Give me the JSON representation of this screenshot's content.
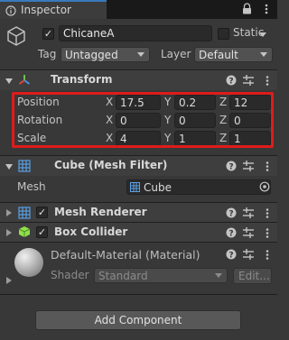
{
  "tab": {
    "label": "Inspector"
  },
  "object": {
    "active": true,
    "name": "ChicaneA",
    "static_label": "Static",
    "static_checked": false,
    "tag_label": "Tag",
    "tag_value": "Untagged",
    "layer_label": "Layer",
    "layer_value": "Default"
  },
  "transform": {
    "title": "Transform",
    "rows": [
      {
        "label": "Position",
        "x": "17.5",
        "y": "0.2",
        "z": "12"
      },
      {
        "label": "Rotation",
        "x": "0",
        "y": "0",
        "z": "0"
      },
      {
        "label": "Scale",
        "x": "4",
        "y": "1",
        "z": "1"
      }
    ],
    "axis_labels": {
      "x": "X",
      "y": "Y",
      "z": "Z"
    }
  },
  "mesh_filter": {
    "title": "Cube (Mesh Filter)",
    "mesh_label": "Mesh",
    "mesh_value": "Cube"
  },
  "mesh_renderer": {
    "title": "Mesh Renderer",
    "enabled": true
  },
  "box_collider": {
    "title": "Box Collider",
    "enabled": true
  },
  "material": {
    "title": "Default-Material (Material)",
    "shader_label": "Shader",
    "shader_value": "Standard",
    "edit_label": "Edit..."
  },
  "add_component_label": "Add Component",
  "colors": {
    "background": "#383838",
    "tab_accent": "#3a79bb",
    "highlight_box": "#e01b1b",
    "transform_icon": [
      "#e0473c",
      "#6cc24a",
      "#4a8fe0"
    ],
    "collider_icon": "#8fe04a"
  }
}
